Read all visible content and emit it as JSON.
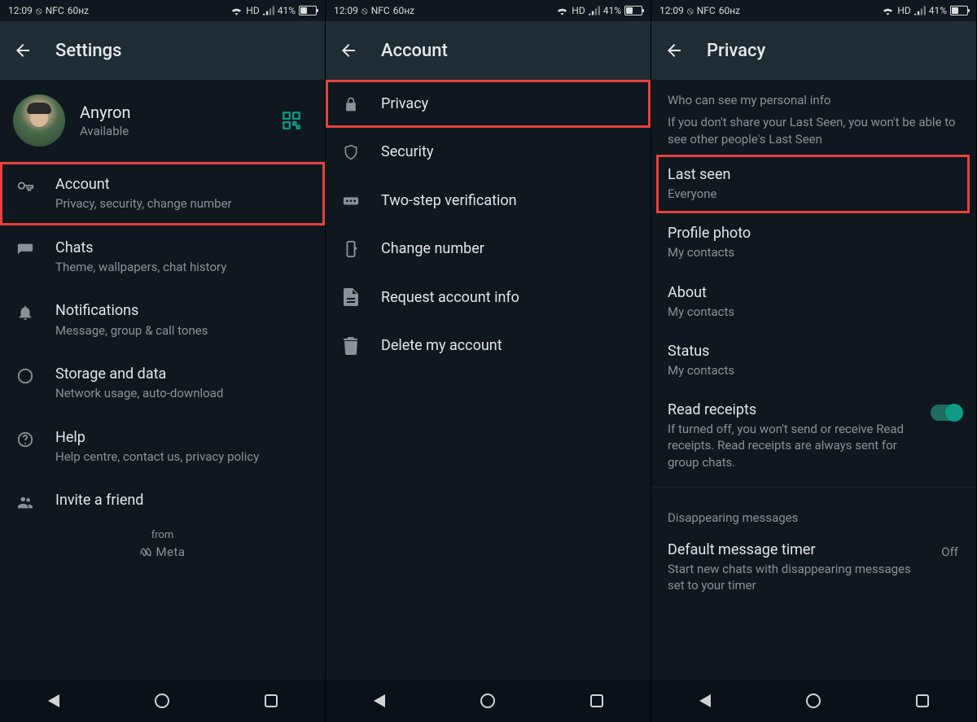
{
  "status": {
    "time": "12:09",
    "nfc": "NFC",
    "refresh": "60нz",
    "hd": "HD",
    "battery_pct": "41%"
  },
  "screens": {
    "settings": {
      "title": "Settings",
      "profile": {
        "name": "Anyron",
        "status": "Available"
      },
      "items": [
        {
          "title": "Account",
          "subtitle": "Privacy, security, change number",
          "icon": "key"
        },
        {
          "title": "Chats",
          "subtitle": "Theme, wallpapers, chat history",
          "icon": "chat"
        },
        {
          "title": "Notifications",
          "subtitle": "Message, group & call tones",
          "icon": "bell"
        },
        {
          "title": "Storage and data",
          "subtitle": "Network usage, auto-download",
          "icon": "data"
        },
        {
          "title": "Help",
          "subtitle": "Help centre, contact us, privacy policy",
          "icon": "help"
        },
        {
          "title": "Invite a friend",
          "subtitle": "",
          "icon": "people"
        }
      ],
      "from": "from",
      "meta": "Meta"
    },
    "account": {
      "title": "Account",
      "items": [
        {
          "title": "Privacy",
          "icon": "lock"
        },
        {
          "title": "Security",
          "icon": "shield"
        },
        {
          "title": "Two-step verification",
          "icon": "pin"
        },
        {
          "title": "Change number",
          "icon": "phone-swap"
        },
        {
          "title": "Request account info",
          "icon": "doc"
        },
        {
          "title": "Delete my account",
          "icon": "trash"
        }
      ]
    },
    "privacy": {
      "title": "Privacy",
      "section_title": "Who can see my personal info",
      "section_note": "If you don't share your Last Seen, you won't be able to see other people's Last Seen",
      "rows": [
        {
          "title": "Last seen",
          "value": "Everyone"
        },
        {
          "title": "Profile photo",
          "value": "My contacts"
        },
        {
          "title": "About",
          "value": "My contacts"
        },
        {
          "title": "Status",
          "value": "My contacts"
        }
      ],
      "read_receipts": {
        "title": "Read receipts",
        "desc": "If turned off, you won't send or receive Read receipts. Read receipts are always sent for group chats.",
        "on": true
      },
      "disappearing_header": "Disappearing messages",
      "disappearing": {
        "title": "Default message timer",
        "desc": "Start new chats with disappearing messages set to your timer",
        "value": "Off"
      }
    }
  }
}
